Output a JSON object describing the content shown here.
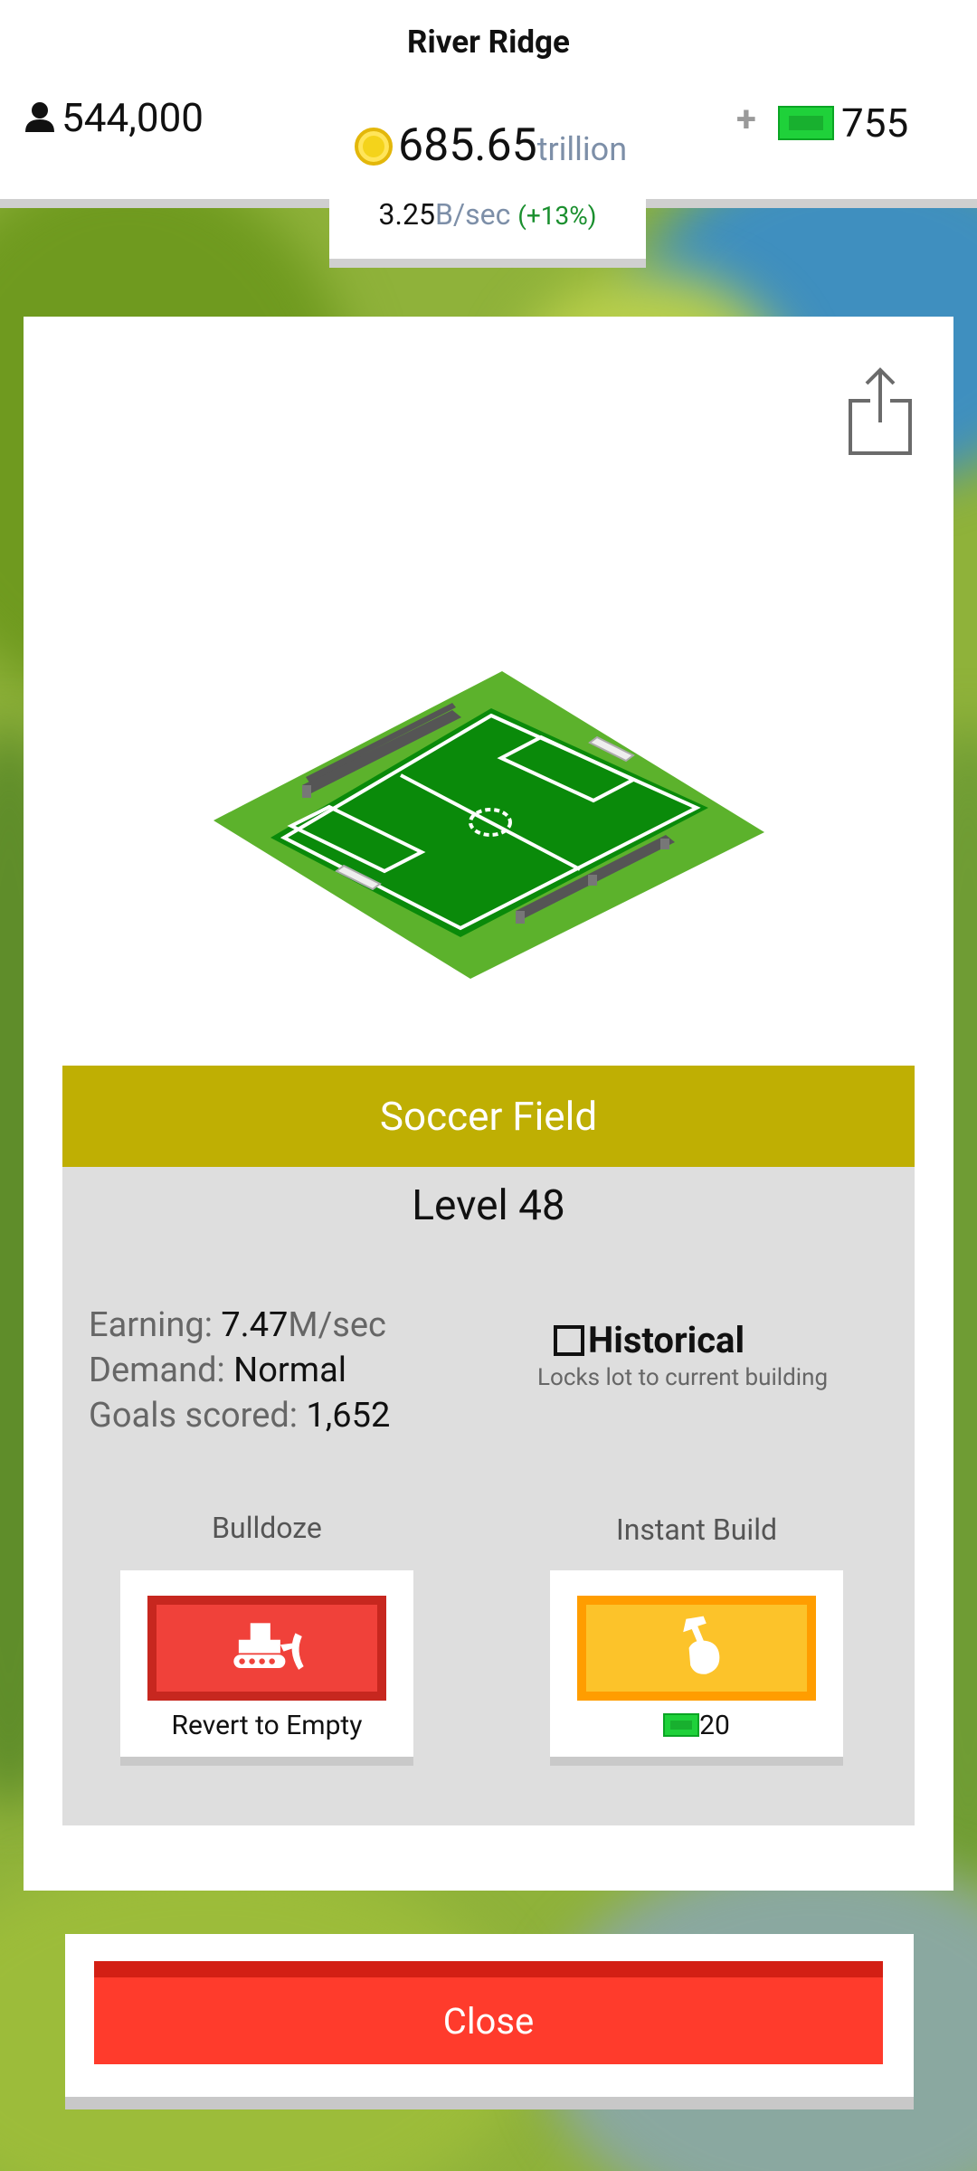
{
  "header": {
    "city_name": "River Ridge",
    "population": "544,000",
    "cash_amount": "685.65",
    "cash_unit": "trillion",
    "bucks_plus": "+",
    "bucks_count": "755",
    "rate_value": "3.25",
    "rate_unit": "B/sec",
    "rate_percent": "(+13%)"
  },
  "building": {
    "name": "Soccer Field",
    "level": "Level 48",
    "stats": [
      {
        "label": "Earning: ",
        "value": "7.47",
        "unit": "M/sec"
      },
      {
        "label": "Demand: ",
        "value": "Normal",
        "unit": ""
      },
      {
        "label": "Goals scored: ",
        "value": "1,652",
        "unit": ""
      }
    ],
    "historical": {
      "label": "Historical",
      "note": "Locks lot to current building",
      "checked": false
    }
  },
  "actions": {
    "bulldoze_label": "Bulldoze",
    "bulldoze_caption": "Revert to Empty",
    "instant_build_label": "Instant Build",
    "instant_build_cost": "20"
  },
  "footer": {
    "close_label": "Close"
  },
  "icons": {
    "share": "share-icon",
    "person": "person-icon",
    "coin": "coin-icon",
    "bill": "bucks-icon",
    "bulldozer": "bulldozer-icon",
    "hammer": "hammer-hand-icon"
  },
  "colors": {
    "title_bar": "#bfaf03",
    "bulldoze_button": "#f0413a",
    "instant_build_button": "#fcc32a",
    "close_button": "#ff3b2c",
    "bucks": "#1fd13a"
  }
}
